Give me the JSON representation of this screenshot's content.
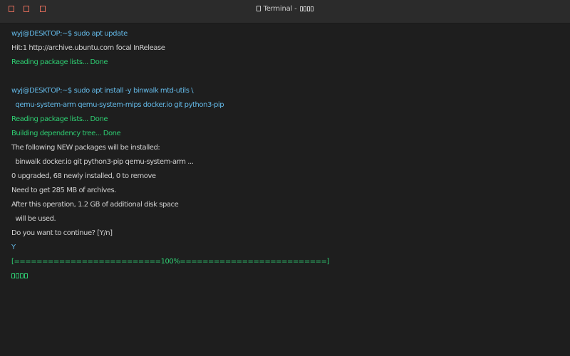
{
  "window": {
    "title": "Terminal - ",
    "title_glyph_count": 4,
    "buttons": [
      "close",
      "minimize",
      "maximize"
    ],
    "background": "#1e1e1e",
    "titlebar_background": "#2b2b2b"
  },
  "colors": {
    "prompt": "#63b8e6",
    "output": "#d0d0d0",
    "success": "#2ecc71",
    "window_button": "#e06c5a"
  },
  "terminal": {
    "lines": [
      {
        "kind": "prompt",
        "text": "wyj@DESKTOP:~$ sudo apt update"
      },
      {
        "kind": "out",
        "text": "Hit:1 http://archive.ubuntu.com focal InRelease"
      },
      {
        "kind": "ok",
        "text": "Reading package lists... Done"
      },
      {
        "kind": "blank",
        "text": ""
      },
      {
        "kind": "prompt",
        "text": "wyj@DESKTOP:~$ sudo apt install -y binwalk mtd-utils \\"
      },
      {
        "kind": "prompt",
        "text": "  qemu-system-arm qemu-system-mips docker.io git python3-pip"
      },
      {
        "kind": "ok",
        "text": "Reading package lists... Done"
      },
      {
        "kind": "ok",
        "text": "Building dependency tree... Done"
      },
      {
        "kind": "out",
        "text": "The following NEW packages will be installed:"
      },
      {
        "kind": "out",
        "text": "  binwalk docker.io git python3-pip qemu-system-arm ..."
      },
      {
        "kind": "out",
        "text": "0 upgraded, 68 newly installed, 0 to remove"
      },
      {
        "kind": "out",
        "text": "Need to get 285 MB of archives."
      },
      {
        "kind": "out",
        "text": "After this operation, 1.2 GB of additional disk space"
      },
      {
        "kind": "out",
        "text": "  will be used."
      },
      {
        "kind": "out",
        "text": "Do you want to continue? [Y/n]"
      },
      {
        "kind": "input",
        "text": "Y"
      },
      {
        "kind": "ok",
        "text": "[==========================100%==========================]"
      }
    ],
    "final_glyph_count": 4
  }
}
